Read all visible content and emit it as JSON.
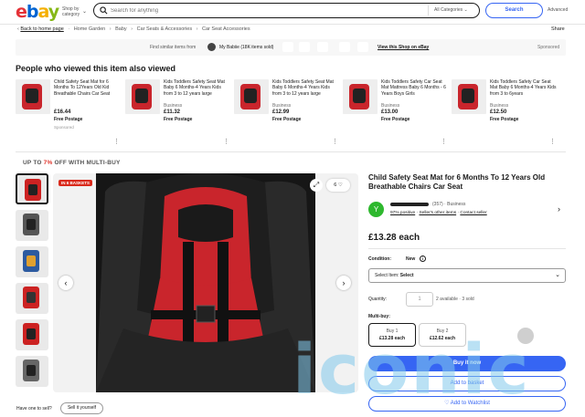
{
  "header": {
    "shop_by_category": "Shop by category",
    "search_placeholder": "Search for anything",
    "all_categories": "All Categories",
    "search_button": "Search",
    "advanced": "Advanced"
  },
  "breadcrumb": {
    "back": "Back to home page",
    "items": [
      "Home Garden",
      "Baby",
      "Car Seats & Accessories",
      "Car Seat Accessories"
    ],
    "share": "Share"
  },
  "similar_bar": {
    "label": "Find similar items from",
    "seller": "My Babiie (18K items sold)",
    "view_link": "View this Shop on eBay",
    "sponsored": "Sponsored"
  },
  "also_viewed": {
    "heading": "People who viewed this item also viewed",
    "items": [
      {
        "title": "Child Safety Seat Mat for 6 Months To 12Years Old Kid Breathable Chairs Car Seat",
        "condition": "",
        "price": "£16.44",
        "shipping": "Free Postage",
        "sponsored": "Sponsored"
      },
      {
        "title": "Kids Toddlers Safety Seat Mat Baby 6 Months-4 Years Kids from 3 to 12 years large",
        "condition": "Business",
        "price": "£11.32",
        "shipping": "Free Postage",
        "sponsored": ""
      },
      {
        "title": "Kids Toddlers Safety Seat Mat Baby 6 Months-4 Years Kids from 3 to 12 years large",
        "condition": "Business",
        "price": "£12.99",
        "shipping": "Free Postage",
        "sponsored": ""
      },
      {
        "title": "Kids Toddlers Safety Car Seat Mat Mattress Baby 6 Months - 6 Years Boys Girls",
        "condition": "Business",
        "price": "£13.00",
        "shipping": "Free Postage",
        "sponsored": ""
      },
      {
        "title": "Kids Toddlers Safety Car Seat Mat Baby 6 Months-4 Years Kids from 3 to 6years",
        "condition": "Business",
        "price": "£12.50",
        "shipping": "Free Postage",
        "sponsored": ""
      }
    ]
  },
  "promo": {
    "prefix": "UP TO ",
    "pct": "7%",
    "suffix": " OFF WITH MULTI-BUY"
  },
  "gallery": {
    "badge": "IN 6 BASKETS",
    "watch_count": "6",
    "nav_prev": "‹",
    "nav_next": "›",
    "expand": "⤢"
  },
  "product": {
    "title": "Child Safety Seat Mat for 6 Months To 12 Years Old Breathable Chairs Car Seat",
    "seller_initial": "Y",
    "seller_meta": "(357) · Business",
    "seller_links": [
      "97% positive",
      "Seller's other items",
      "Contact seller"
    ],
    "price": "£13.28 each",
    "condition_label": "Condition:",
    "condition_value": "New",
    "select_label": "Select Item:",
    "select_value": "Select",
    "quantity_label": "Quantity:",
    "quantity_value": "1",
    "availability": "2 available · 3 sold",
    "multibuy_label": "Multi-buy:",
    "multibuy": [
      {
        "qty": "Buy 1",
        "price": "£13.28 each"
      },
      {
        "qty": "Buy 2",
        "price": "£12.62 each"
      }
    ],
    "buy_now": "Buy it now",
    "add_basket": "Add to basket",
    "add_watchlist": "♡ Add to Watchlist"
  },
  "sell": {
    "question": "Have one to sell?",
    "button": "Sell it yourself"
  },
  "watermark": "iconic",
  "colors": {
    "accent": "#3665f3",
    "badge": "#d92a1c",
    "seat_red": "#c9252c"
  }
}
